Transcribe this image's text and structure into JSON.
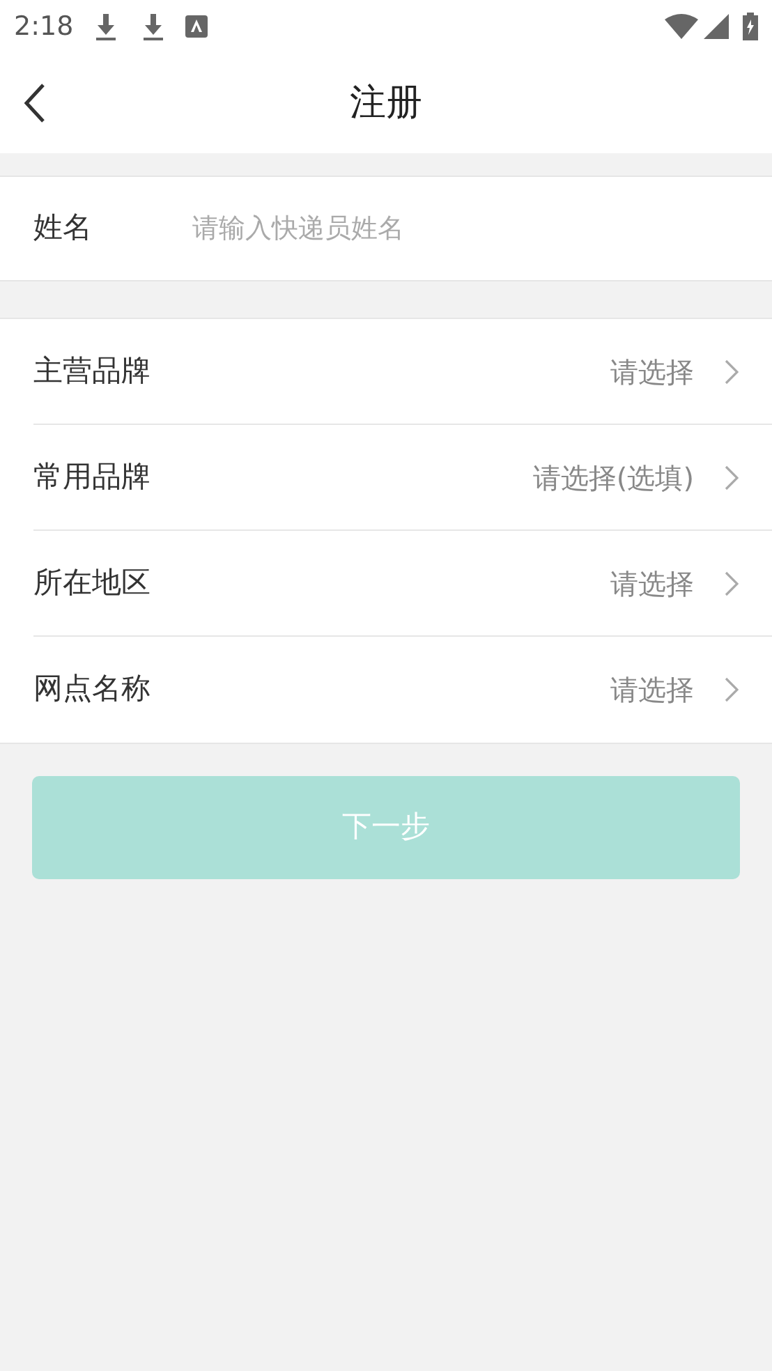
{
  "status_bar": {
    "time": "2:18"
  },
  "header": {
    "title": "注册"
  },
  "name_field": {
    "label": "姓名",
    "placeholder": "请输入快递员姓名"
  },
  "rows": [
    {
      "label": "主营品牌",
      "value": "请选择"
    },
    {
      "label": "常用品牌",
      "value": "请选择(选填)"
    },
    {
      "label": "所在地区",
      "value": "请选择"
    },
    {
      "label": "网点名称",
      "value": "请选择"
    }
  ],
  "next_button": {
    "label": "下一步",
    "disabled": true
  }
}
